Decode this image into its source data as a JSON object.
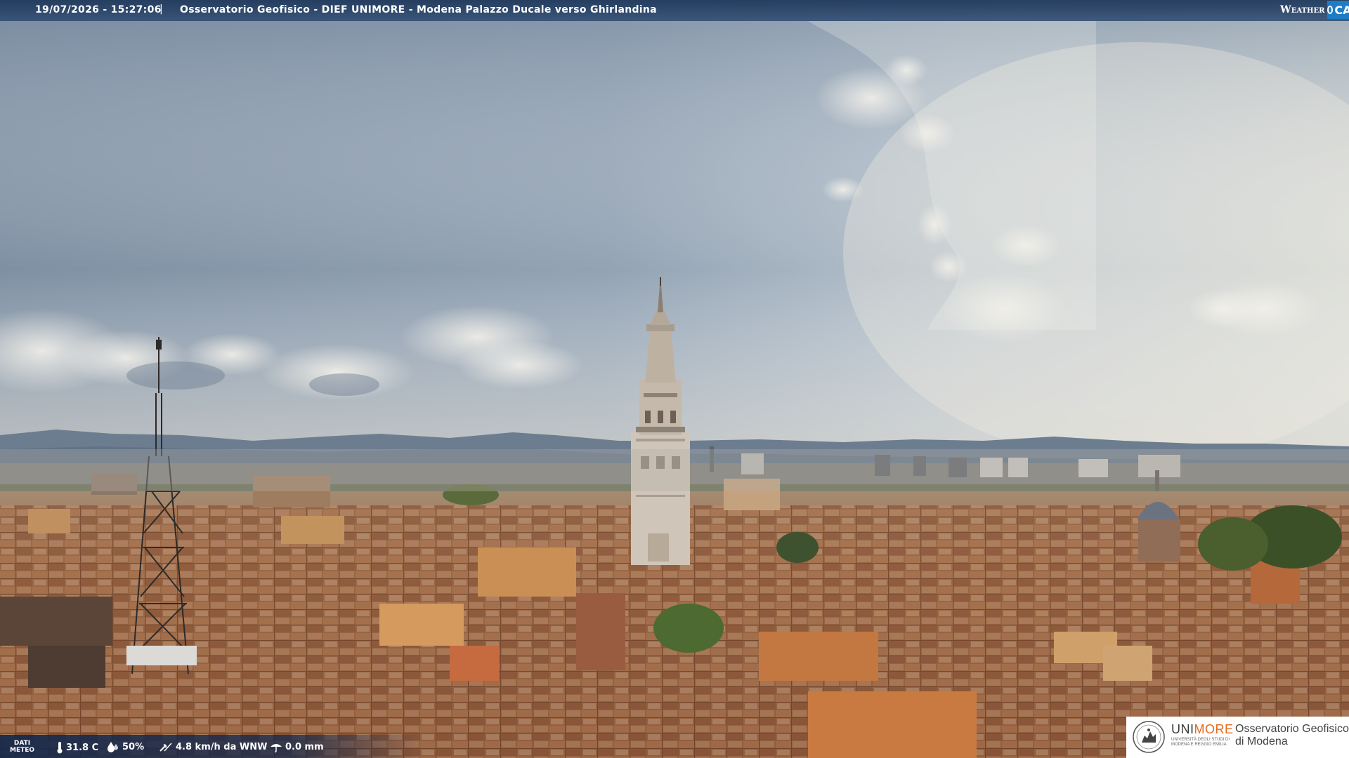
{
  "header": {
    "timestamp": "19/07/2026 - 15:27:06",
    "separator": "|",
    "title": "Osservatorio Geofisico - DIEF UNIMORE - Modena Palazzo Ducale verso Ghirlandina"
  },
  "brand": {
    "weather": "Weather",
    "cam": "CAM",
    "accent": "#1f7cc4"
  },
  "meteo": {
    "label_line1": "DATI",
    "label_line2": "METEO",
    "temperature": "31.8 C",
    "humidity": "50%",
    "wind": "4.8 km/h da WNW",
    "rain": "0.0 mm",
    "icons": [
      "thermometer-icon",
      "humidity-icon",
      "wind-icon",
      "rain-icon"
    ]
  },
  "logo": {
    "uni_part1": "UNI",
    "uni_part2": "MORE",
    "uni_sub": "UNIVERSITÀ DEGLI STUDI DI MODENA E REGGIO EMILIA",
    "obs_line1": "Osservatorio Geofisico",
    "obs_line2": "di Modena",
    "orange": "#e36a1e"
  }
}
